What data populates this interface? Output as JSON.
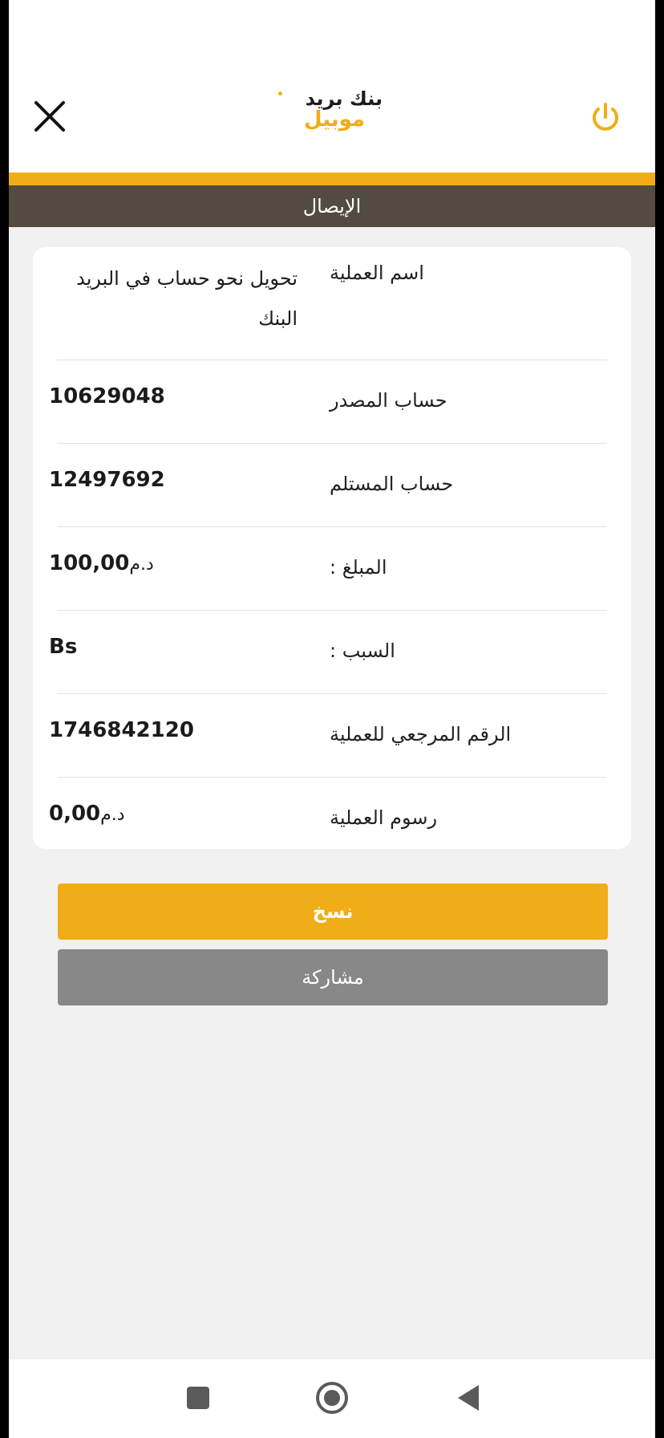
{
  "header": {
    "logo": {
      "top_words": [
        "بريد",
        "بنك"
      ],
      "bottom_word": "موبيل"
    }
  },
  "title_bar": {
    "title": "الإيصال"
  },
  "receipt": {
    "rows": [
      {
        "label": "اسم العملية",
        "value": "تحويل نحو حساب في البريد البنك"
      },
      {
        "label": "حساب المصدر",
        "value": "10629048"
      },
      {
        "label": "حساب المستلم",
        "value": "12497692"
      },
      {
        "label": "المبلغ :",
        "value": "100,00",
        "unit": "د.م"
      },
      {
        "label": "السبب :",
        "value": "Bs"
      },
      {
        "label": "الرقم المرجعي للعملية",
        "value": "1746842120"
      },
      {
        "label": "رسوم العملية",
        "value": "0,00",
        "unit": "د.م"
      }
    ]
  },
  "actions": {
    "copy_label": "نسخ",
    "share_label": "مشاركة"
  },
  "icons": {
    "close": "close-icon",
    "power": "power-icon",
    "nav_recents": "square-icon",
    "nav_home": "circle-icon",
    "nav_back": "triangle-back-icon"
  },
  "colors": {
    "accent": "#f0ad17",
    "title_bar": "#534a42",
    "share_button": "#888888"
  }
}
